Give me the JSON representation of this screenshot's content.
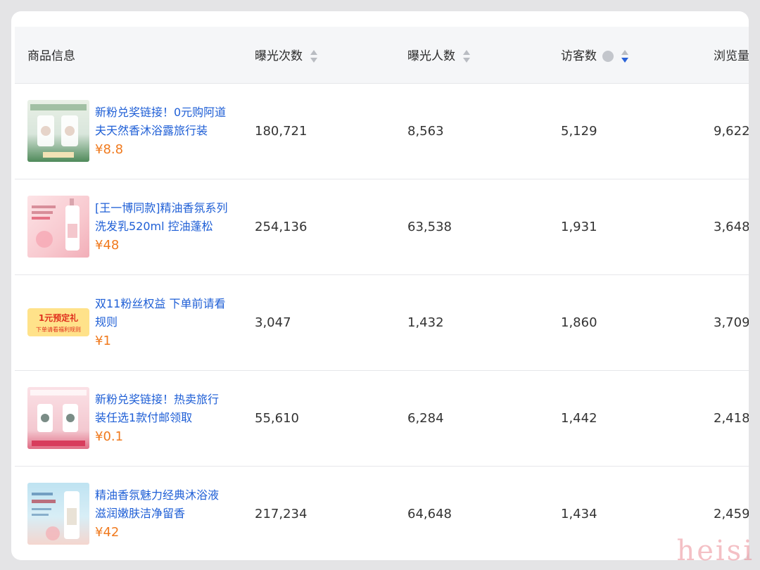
{
  "columns": [
    {
      "label": "商品信息"
    },
    {
      "label": "曝光次数"
    },
    {
      "label": "曝光人数"
    },
    {
      "label": "访客数"
    },
    {
      "label": "浏览量"
    }
  ],
  "rows": [
    {
      "title": "新粉兑奖链接！0元购阿道夫天然香沐浴露旅行装",
      "price": "¥8.8",
      "impressions": "180,721",
      "reach": "8,563",
      "visitors": "5,129",
      "views": "9,622"
    },
    {
      "title": "[王一博同款]精油香氛系列洗发乳520ml 控油蓬松",
      "price": "¥48",
      "impressions": "254,136",
      "reach": "63,538",
      "visitors": "1,931",
      "views": "3,648"
    },
    {
      "title": "双11粉丝权益 下单前请看规则",
      "price": "¥1",
      "impressions": "3,047",
      "reach": "1,432",
      "visitors": "1,860",
      "views": "3,709"
    },
    {
      "title": "新粉兑奖链接！热卖旅行装任选1款付邮领取",
      "price": "¥0.1",
      "impressions": "55,610",
      "reach": "6,284",
      "visitors": "1,442",
      "views": "2,418"
    },
    {
      "title": "精油香氛魅力经典沐浴液 滋润嫩肤洁净留香",
      "price": "¥42",
      "impressions": "217,234",
      "reach": "64,648",
      "visitors": "1,434",
      "views": "2,459"
    }
  ],
  "thumb3_text": [
    "1元预定礼",
    "下单请看福利规则"
  ],
  "corner_watermark": "heisi",
  "colors": {
    "link_blue": "#1f5fd6",
    "price_orange": "#f07a1e",
    "sort_active": "#2a62d8",
    "sort_inactive": "#b9bcc2"
  }
}
